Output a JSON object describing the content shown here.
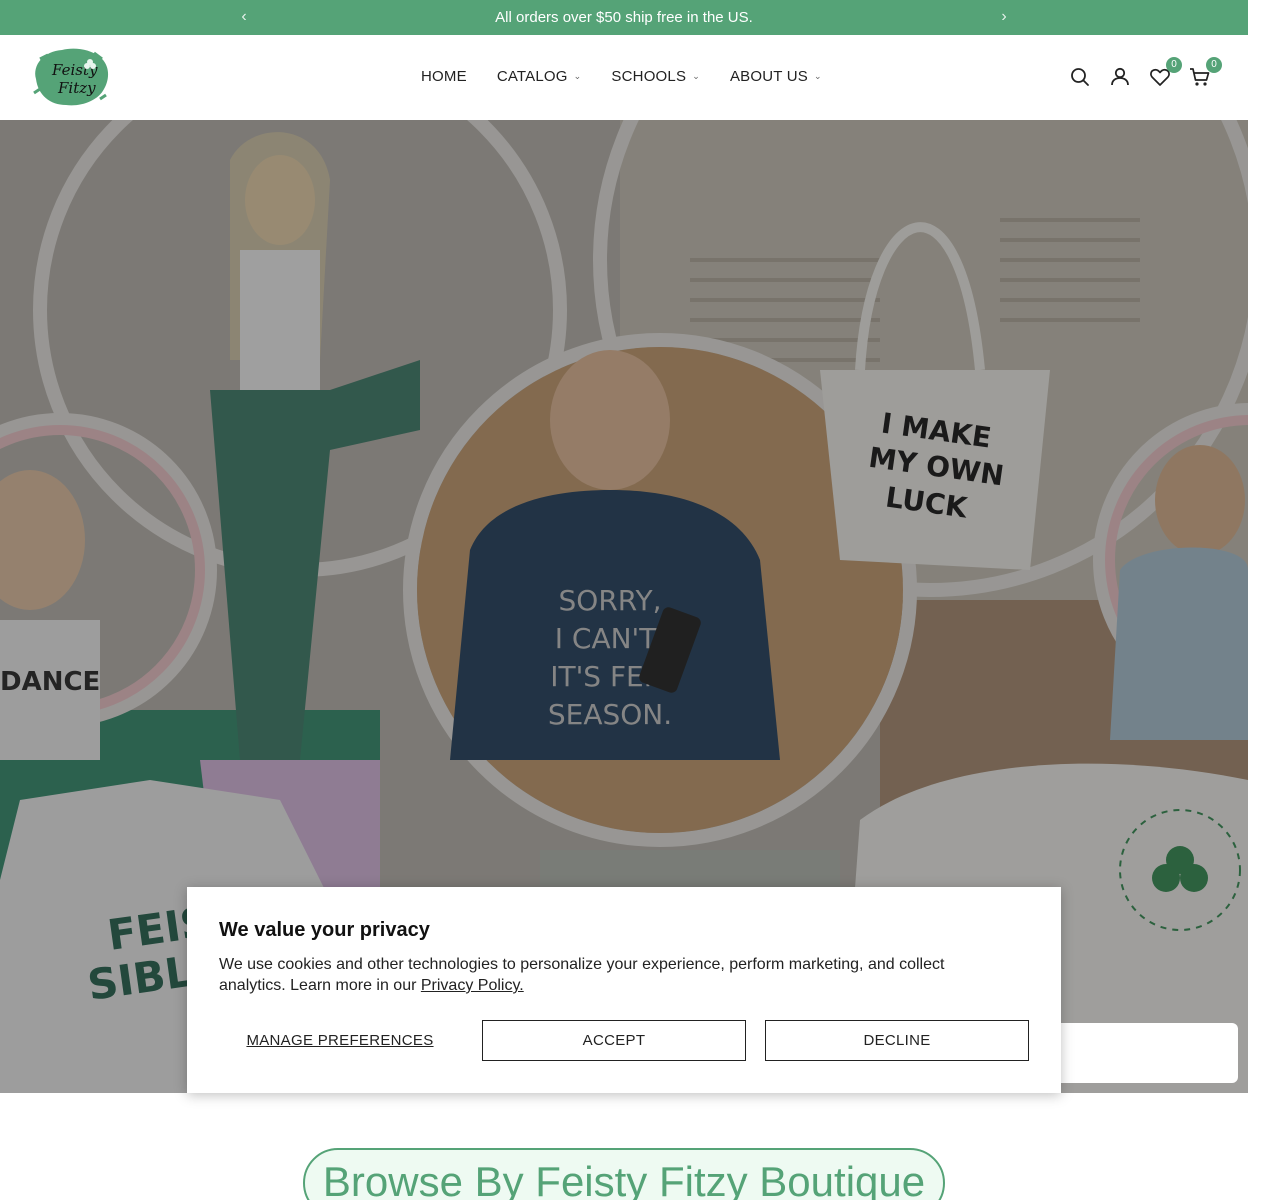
{
  "announcement": {
    "message": "All orders over $50 ship free in the US.",
    "prev_icon": "chevron-left-icon",
    "next_icon": "chevron-right-icon"
  },
  "brand": {
    "logo_text_line1": "Feisty",
    "logo_text_line2": "Fitzy",
    "accent_color": "#55a377"
  },
  "nav": {
    "items": [
      {
        "label": "HOME",
        "has_dropdown": false
      },
      {
        "label": "CATALOG",
        "has_dropdown": true
      },
      {
        "label": "SCHOOLS",
        "has_dropdown": true
      },
      {
        "label": "ABOUT US",
        "has_dropdown": true
      }
    ]
  },
  "header_icons": {
    "search": "search-icon",
    "account": "account-icon",
    "wishlist": "heart-icon",
    "wishlist_count": "0",
    "cart": "cart-icon",
    "cart_count": "0"
  },
  "hero": {
    "tote_text": "I MAKE MY OWN LUCK",
    "sweatshirt_text": "SORRY, I CAN'T, IT'S FEIS SEASON."
  },
  "cookie_banner": {
    "title": "We value your privacy",
    "body": "We use cookies and other technologies to personalize your experience, perform marketing, and collect analytics. Learn more in our ",
    "policy_link": "Privacy Policy.",
    "manage_label": "MANAGE PREFERENCES",
    "accept_label": "ACCEPT",
    "decline_label": "DECLINE"
  },
  "browse": {
    "heading": "Browse By Feisty Fitzy Boutique"
  }
}
